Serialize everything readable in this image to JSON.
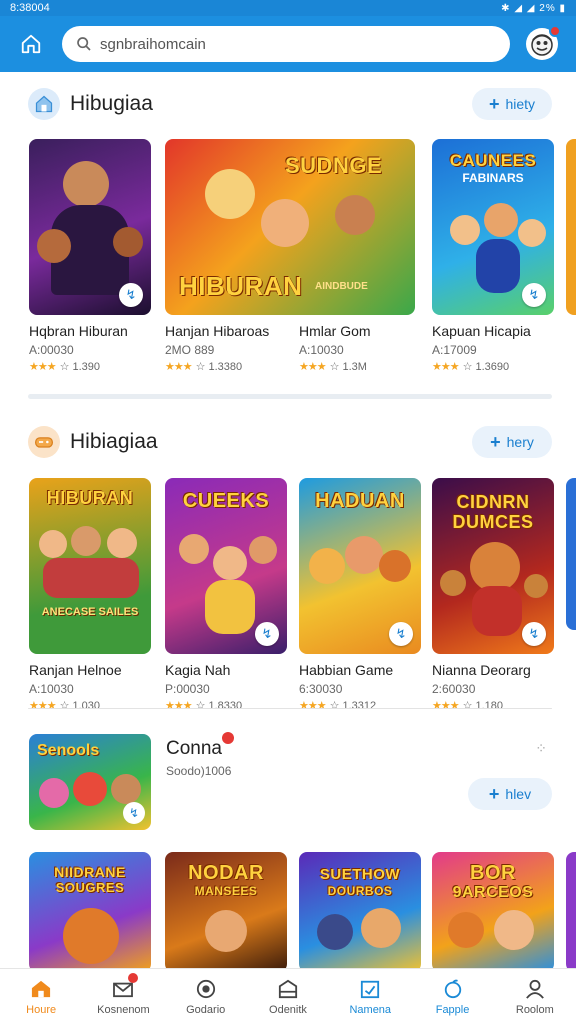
{
  "status_bar": {
    "time": "8:38004",
    "icons": "✱ ◢ ◢ 2% ▮"
  },
  "search": {
    "value": "sgnbraihomcain"
  },
  "section1": {
    "title": "Hibugiaa",
    "more_label": "hiety",
    "cards": [
      {
        "art_title": "",
        "name": "Hqbran Hiburan",
        "sub": "A:00030",
        "stars": "★★★",
        "rating": "☆ 1.390"
      },
      {
        "art_title": "SUDNGE",
        "art_subtitle": "HIBURAN",
        "art_tag": "AINDBUDE",
        "name": "Hanjan Hibaroas",
        "sub": "2MO 889",
        "stars": "★★★",
        "rating": "☆ 1.3380"
      },
      {
        "name": "Hmlar Gom",
        "sub": "A:10030",
        "stars": "★★★",
        "rating": "☆ 1.3M"
      },
      {
        "art_title": "CAUNEES",
        "art_subtitle": "FABINARS",
        "name": "Kapuan Hicapia",
        "sub": "A:17009",
        "stars": "★★★",
        "rating": "☆ 1.3690"
      }
    ]
  },
  "section2": {
    "title": "Hibiagiaa",
    "more_label": "hery",
    "cards": [
      {
        "art_title": "HIBURAN",
        "art_tag": "ANECASE SAILES",
        "name": "Ranjan Helnoe",
        "sub": "A:10030",
        "stars": "★★★",
        "rating": "☆ 1.030"
      },
      {
        "art_title": "CUEEKS",
        "name": "Kagia Nah",
        "sub": "P:00030",
        "stars": "★★★",
        "rating": "☆ 1.8330"
      },
      {
        "art_title": "HADUAN",
        "name": "Habbian Game",
        "sub": "6:30030",
        "stars": "★★★",
        "rating": "☆ 1.3312"
      },
      {
        "art_title": "CIDNRN",
        "art_subtitle": "DUMCES",
        "name": "Nianna Deorarg",
        "sub": "2:60030",
        "stars": "★★★",
        "rating": "☆ 1.180"
      }
    ]
  },
  "feature": {
    "art_title": "Senools",
    "title": "Conna",
    "sub": "Soodo)1006",
    "more_label": "hlev"
  },
  "section3": {
    "cards": [
      {
        "art_title": "NIIDRANE",
        "art_subtitle": "SOUGRES"
      },
      {
        "art_title": "NODAR",
        "art_subtitle": "MANSEES"
      },
      {
        "art_title": "SUETHOW",
        "art_subtitle": "DOURBOS"
      },
      {
        "art_title": "BOR",
        "art_subtitle": "9ARCEOS"
      }
    ]
  },
  "bottom_nav": [
    {
      "label": "Houre"
    },
    {
      "label": "Kosnenom"
    },
    {
      "label": "Godario"
    },
    {
      "label": "Odenitk"
    },
    {
      "label": "Namena"
    },
    {
      "label": "Fapple"
    },
    {
      "label": "Roolom"
    }
  ],
  "colors": {
    "primary": "#1c8fe0",
    "accent_orange": "#f08a1c",
    "star": "#f5a623"
  }
}
